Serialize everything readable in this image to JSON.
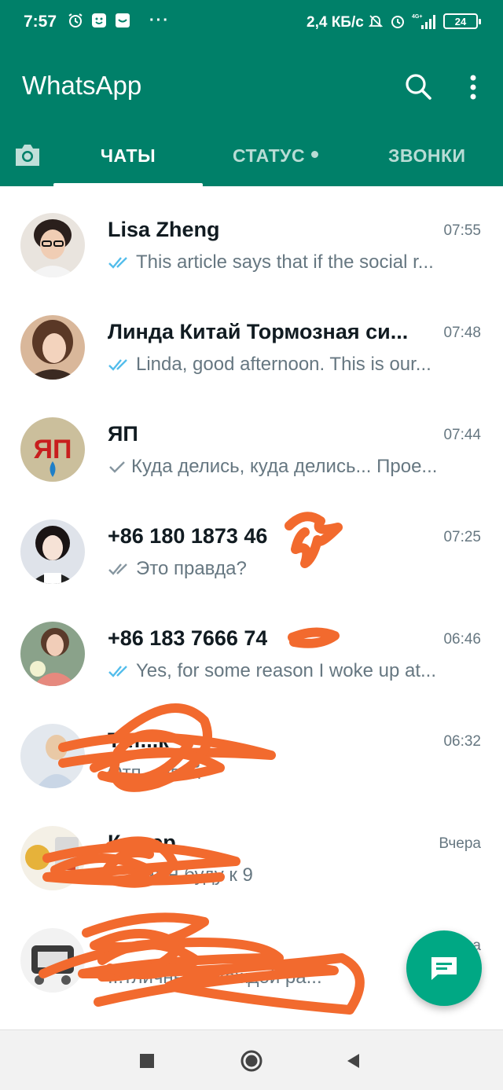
{
  "status_bar": {
    "time": "7:57",
    "dots": "···",
    "speed": "2,4 КБ/с",
    "network": "4G+",
    "battery": "24"
  },
  "app": {
    "title": "WhatsApp",
    "accent": "#008069",
    "fab_color": "#00a884",
    "read_tick_color": "#53bdeb"
  },
  "tabs": [
    {
      "label": "ЧАТЫ",
      "active": true
    },
    {
      "label": "СТАТУС",
      "active": false
    },
    {
      "label": "ЗВОНКИ",
      "active": false
    }
  ],
  "chats": [
    {
      "name": "Lisa Zheng",
      "time": "07:55",
      "tick": "double-blue",
      "preview": "This article says that if the social r..."
    },
    {
      "name": "Линда Китай Тормозная си...",
      "time": "07:48",
      "tick": "double-blue",
      "preview": "Linda, good afternoon.  This is our..."
    },
    {
      "name": "ЯП",
      "time": "07:44",
      "tick": "single-grey",
      "preview": "Куда делись, куда делись... Прое...",
      "avatar_text": "ЯП"
    },
    {
      "name": "+86 180 1873 46",
      "time": "07:25",
      "tick": "double-grey",
      "preview": "Это правда?"
    },
    {
      "name": "+86 183 7666 74",
      "time": "06:46",
      "tick": "double-blue",
      "preview": "Yes, for some reason I woke up at..."
    },
    {
      "name": "Тат...к",
      "time": "06:32",
      "tick": "none",
      "preview": "Отп...ывай"
    },
    {
      "name": "К...нер",
      "time": "Вчера",
      "tick": "none",
      "preview": "...ана: Я буду к 9"
    },
    {
      "name": "...",
      "time": "...а",
      "tick": "none",
      "preview": "...тличные к каждой ра..."
    }
  ],
  "icons": {
    "search": "search-icon",
    "menu": "more-vert-icon",
    "camera": "camera-icon",
    "fab": "new-chat-icon",
    "nav_recents": "square-icon",
    "nav_home": "circle-icon",
    "nav_back": "triangle-back-icon"
  }
}
